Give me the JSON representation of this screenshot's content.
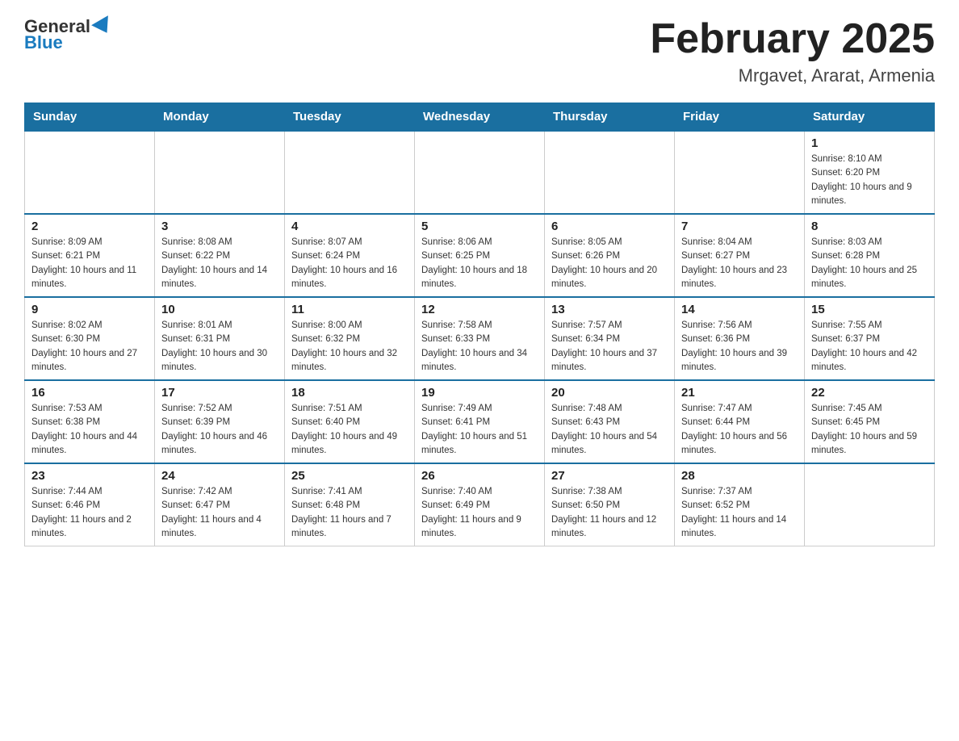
{
  "header": {
    "logo": {
      "general": "General",
      "blue": "Blue"
    },
    "title": "February 2025",
    "location": "Mrgavet, Ararat, Armenia"
  },
  "weekdays": [
    "Sunday",
    "Monday",
    "Tuesday",
    "Wednesday",
    "Thursday",
    "Friday",
    "Saturday"
  ],
  "weeks": [
    [
      {
        "day": "",
        "info": ""
      },
      {
        "day": "",
        "info": ""
      },
      {
        "day": "",
        "info": ""
      },
      {
        "day": "",
        "info": ""
      },
      {
        "day": "",
        "info": ""
      },
      {
        "day": "",
        "info": ""
      },
      {
        "day": "1",
        "info": "Sunrise: 8:10 AM\nSunset: 6:20 PM\nDaylight: 10 hours and 9 minutes."
      }
    ],
    [
      {
        "day": "2",
        "info": "Sunrise: 8:09 AM\nSunset: 6:21 PM\nDaylight: 10 hours and 11 minutes."
      },
      {
        "day": "3",
        "info": "Sunrise: 8:08 AM\nSunset: 6:22 PM\nDaylight: 10 hours and 14 minutes."
      },
      {
        "day": "4",
        "info": "Sunrise: 8:07 AM\nSunset: 6:24 PM\nDaylight: 10 hours and 16 minutes."
      },
      {
        "day": "5",
        "info": "Sunrise: 8:06 AM\nSunset: 6:25 PM\nDaylight: 10 hours and 18 minutes."
      },
      {
        "day": "6",
        "info": "Sunrise: 8:05 AM\nSunset: 6:26 PM\nDaylight: 10 hours and 20 minutes."
      },
      {
        "day": "7",
        "info": "Sunrise: 8:04 AM\nSunset: 6:27 PM\nDaylight: 10 hours and 23 minutes."
      },
      {
        "day": "8",
        "info": "Sunrise: 8:03 AM\nSunset: 6:28 PM\nDaylight: 10 hours and 25 minutes."
      }
    ],
    [
      {
        "day": "9",
        "info": "Sunrise: 8:02 AM\nSunset: 6:30 PM\nDaylight: 10 hours and 27 minutes."
      },
      {
        "day": "10",
        "info": "Sunrise: 8:01 AM\nSunset: 6:31 PM\nDaylight: 10 hours and 30 minutes."
      },
      {
        "day": "11",
        "info": "Sunrise: 8:00 AM\nSunset: 6:32 PM\nDaylight: 10 hours and 32 minutes."
      },
      {
        "day": "12",
        "info": "Sunrise: 7:58 AM\nSunset: 6:33 PM\nDaylight: 10 hours and 34 minutes."
      },
      {
        "day": "13",
        "info": "Sunrise: 7:57 AM\nSunset: 6:34 PM\nDaylight: 10 hours and 37 minutes."
      },
      {
        "day": "14",
        "info": "Sunrise: 7:56 AM\nSunset: 6:36 PM\nDaylight: 10 hours and 39 minutes."
      },
      {
        "day": "15",
        "info": "Sunrise: 7:55 AM\nSunset: 6:37 PM\nDaylight: 10 hours and 42 minutes."
      }
    ],
    [
      {
        "day": "16",
        "info": "Sunrise: 7:53 AM\nSunset: 6:38 PM\nDaylight: 10 hours and 44 minutes."
      },
      {
        "day": "17",
        "info": "Sunrise: 7:52 AM\nSunset: 6:39 PM\nDaylight: 10 hours and 46 minutes."
      },
      {
        "day": "18",
        "info": "Sunrise: 7:51 AM\nSunset: 6:40 PM\nDaylight: 10 hours and 49 minutes."
      },
      {
        "day": "19",
        "info": "Sunrise: 7:49 AM\nSunset: 6:41 PM\nDaylight: 10 hours and 51 minutes."
      },
      {
        "day": "20",
        "info": "Sunrise: 7:48 AM\nSunset: 6:43 PM\nDaylight: 10 hours and 54 minutes."
      },
      {
        "day": "21",
        "info": "Sunrise: 7:47 AM\nSunset: 6:44 PM\nDaylight: 10 hours and 56 minutes."
      },
      {
        "day": "22",
        "info": "Sunrise: 7:45 AM\nSunset: 6:45 PM\nDaylight: 10 hours and 59 minutes."
      }
    ],
    [
      {
        "day": "23",
        "info": "Sunrise: 7:44 AM\nSunset: 6:46 PM\nDaylight: 11 hours and 2 minutes."
      },
      {
        "day": "24",
        "info": "Sunrise: 7:42 AM\nSunset: 6:47 PM\nDaylight: 11 hours and 4 minutes."
      },
      {
        "day": "25",
        "info": "Sunrise: 7:41 AM\nSunset: 6:48 PM\nDaylight: 11 hours and 7 minutes."
      },
      {
        "day": "26",
        "info": "Sunrise: 7:40 AM\nSunset: 6:49 PM\nDaylight: 11 hours and 9 minutes."
      },
      {
        "day": "27",
        "info": "Sunrise: 7:38 AM\nSunset: 6:50 PM\nDaylight: 11 hours and 12 minutes."
      },
      {
        "day": "28",
        "info": "Sunrise: 7:37 AM\nSunset: 6:52 PM\nDaylight: 11 hours and 14 minutes."
      },
      {
        "day": "",
        "info": ""
      }
    ]
  ]
}
